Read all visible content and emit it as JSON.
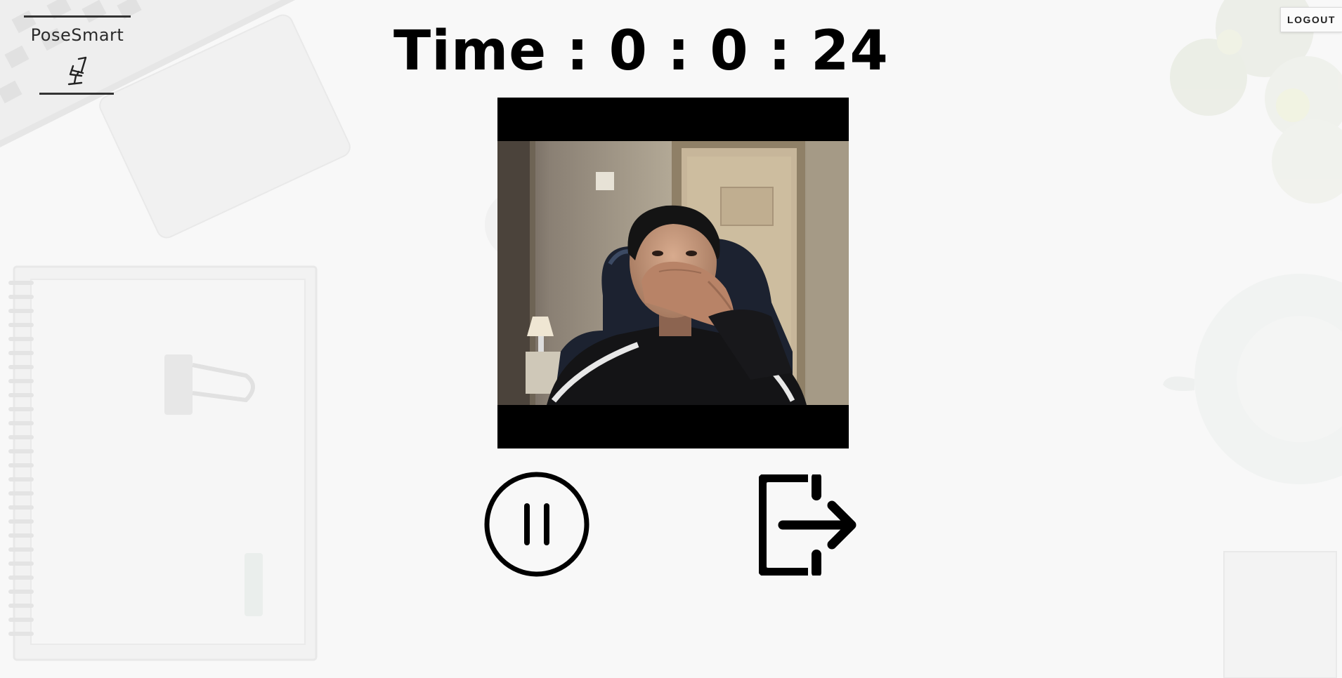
{
  "app": {
    "logo_text": "PoseSmart",
    "logo_icon": "chair-icon"
  },
  "header": {
    "logout_label": "LOGOUT"
  },
  "timer": {
    "label": "Time",
    "hours": "0",
    "minutes": "0",
    "seconds": "24",
    "display": "Time : 0 : 0 : 24"
  },
  "video": {
    "name": "webcam-feed"
  },
  "controls": {
    "pause_icon": "pause-icon",
    "exit_icon": "exit-icon"
  },
  "colors": {
    "background": "#f8f8f8",
    "text": "#000000",
    "video_bg": "#000000"
  }
}
